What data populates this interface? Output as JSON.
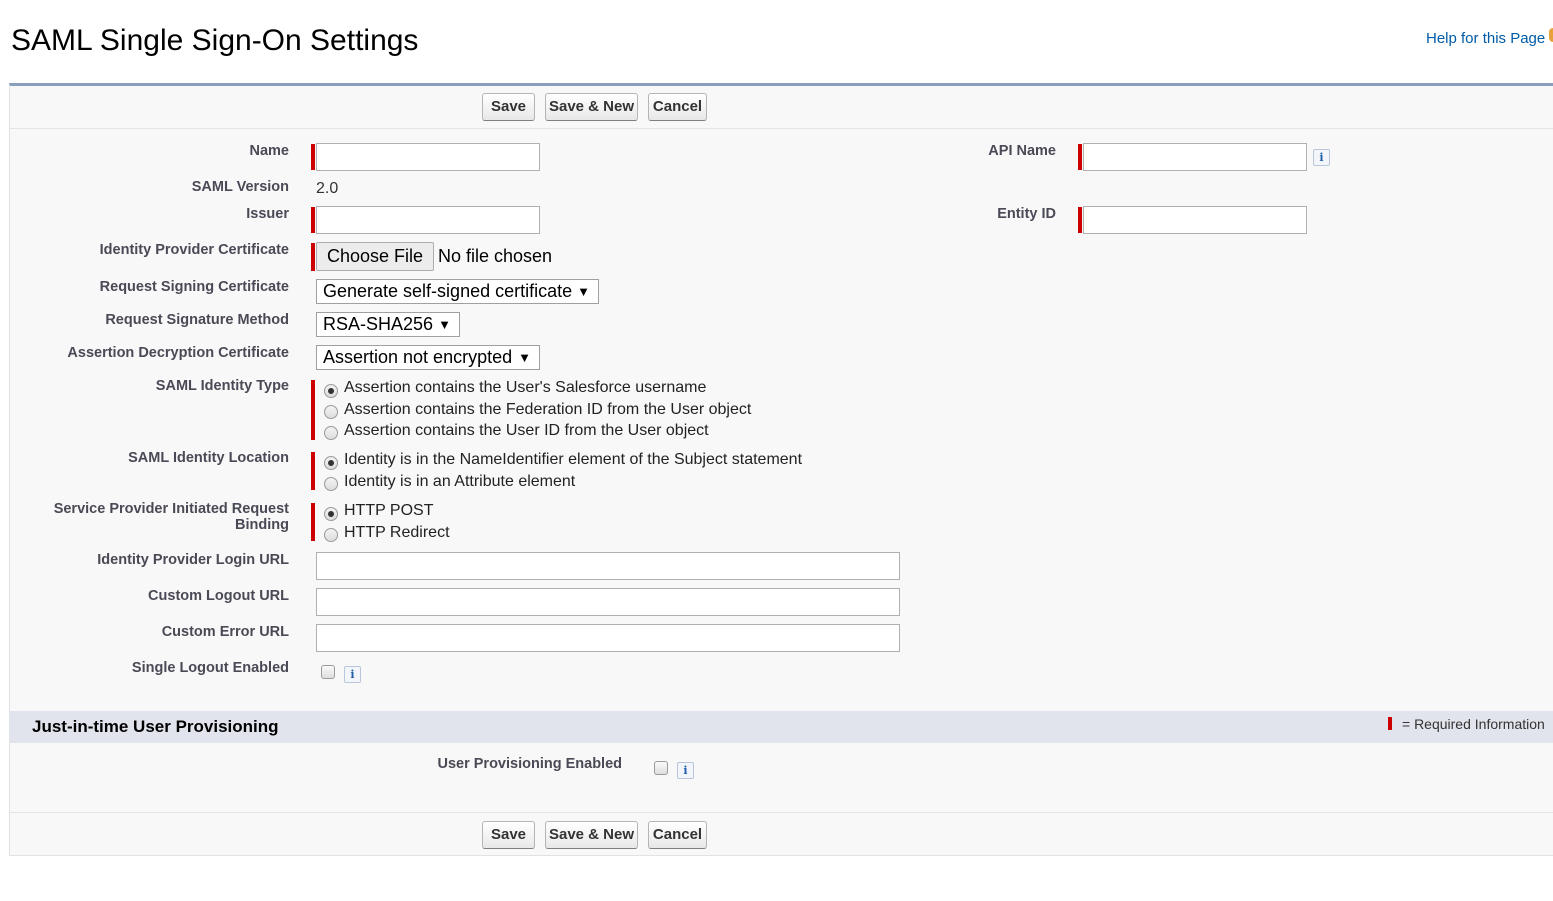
{
  "header": {
    "title": "SAML Single Sign-On Settings",
    "help_link": "Help for this Page"
  },
  "buttons": {
    "save": "Save",
    "save_new": "Save & New",
    "cancel": "Cancel"
  },
  "form": {
    "name": {
      "label": "Name",
      "value": ""
    },
    "api_name": {
      "label": "API Name",
      "value": ""
    },
    "saml_version": {
      "label": "SAML Version",
      "value": "2.0"
    },
    "issuer": {
      "label": "Issuer",
      "value": ""
    },
    "entity_id": {
      "label": "Entity ID",
      "value": ""
    },
    "idp_certificate": {
      "label": "Identity Provider Certificate",
      "button": "Choose File",
      "status": "No file chosen"
    },
    "request_signing_certificate": {
      "label": "Request Signing Certificate",
      "selected": "Generate self-signed certificate"
    },
    "request_signature_method": {
      "label": "Request Signature Method",
      "selected": "RSA-SHA256"
    },
    "assertion_decryption_certificate": {
      "label": "Assertion Decryption Certificate",
      "selected": "Assertion not encrypted"
    },
    "saml_identity_type": {
      "label": "SAML Identity Type",
      "options": [
        "Assertion contains the User's Salesforce username",
        "Assertion contains the Federation ID from the User object",
        "Assertion contains the User ID from the User object"
      ],
      "selected_index": 0
    },
    "saml_identity_location": {
      "label": "SAML Identity Location",
      "options": [
        "Identity is in the NameIdentifier element of the Subject statement",
        "Identity is in an Attribute element"
      ],
      "selected_index": 0
    },
    "sp_request_binding": {
      "label_line1": "Service Provider Initiated Request",
      "label_line2": "Binding",
      "options": [
        "HTTP POST",
        "HTTP Redirect"
      ],
      "selected_index": 0
    },
    "idp_login_url": {
      "label": "Identity Provider Login URL",
      "value": ""
    },
    "custom_logout_url": {
      "label": "Custom Logout URL",
      "value": ""
    },
    "custom_error_url": {
      "label": "Custom Error URL",
      "value": ""
    },
    "single_logout_enabled": {
      "label": "Single Logout Enabled",
      "checked": false
    }
  },
  "jit": {
    "section_title": "Just-in-time User Provisioning",
    "required_legend": "= Required Information",
    "user_provisioning_enabled": {
      "label": "User Provisioning Enabled",
      "checked": false
    }
  },
  "icons": {
    "info": "i",
    "caret": "▼"
  },
  "colors": {
    "required": "#cc0000",
    "section_bar": "#e1e4ec",
    "panel_top_border": "#8a9ebe",
    "link": "#015ba7"
  }
}
